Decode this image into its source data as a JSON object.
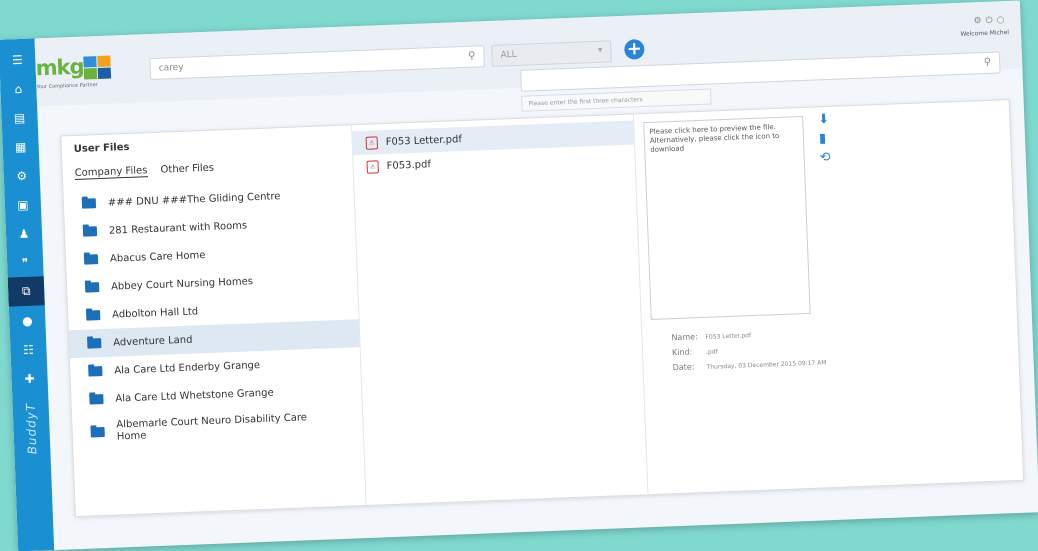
{
  "app": {
    "brand_vertical": "BuddyT"
  },
  "sidebar": {
    "icons": [
      "menu-icon",
      "home-icon",
      "document-icon",
      "calendar-icon",
      "gear-icon",
      "inbox-icon",
      "user-icon",
      "quote-icon",
      "copy-icon",
      "lock-icon",
      "list-icon",
      "add-user-icon"
    ],
    "active_index": 8
  },
  "topbar": {
    "logo_text": "mkg",
    "logo_tagline": "Your Compliance Partner",
    "search_value": "carey",
    "select_value": "ALL",
    "welcome": "Welcome Michel",
    "hint": "Please enter the first three characters"
  },
  "user_files": {
    "title": "User Files",
    "tabs": [
      "Company Files",
      "Other Files"
    ],
    "folders": [
      "### DNU ###The Gliding Centre",
      "281 Restaurant with Rooms",
      "Abacus Care Home",
      "Abbey Court Nursing Homes",
      "Adbolton Hall Ltd",
      "Adventure Land",
      "Ala Care Ltd Enderby Grange",
      "Ala Care Ltd Whetstone Grange",
      "Albemarle Court Neuro Disability Care Home"
    ],
    "selected_folder": 5
  },
  "files": [
    {
      "name": "F053 Letter.pdf",
      "selected": true
    },
    {
      "name": "F053.pdf",
      "selected": false
    }
  ],
  "preview": {
    "message": "Please click here to preview the file. Alternatively, please click the icon to download",
    "meta": {
      "name_label": "Name:",
      "name_value": "F053 Letter.pdf",
      "kind_label": "Kind:",
      "kind_value": ".pdf",
      "date_label": "Date:",
      "date_value": "Thursday, 03 December 2015 09:17 AM"
    }
  }
}
